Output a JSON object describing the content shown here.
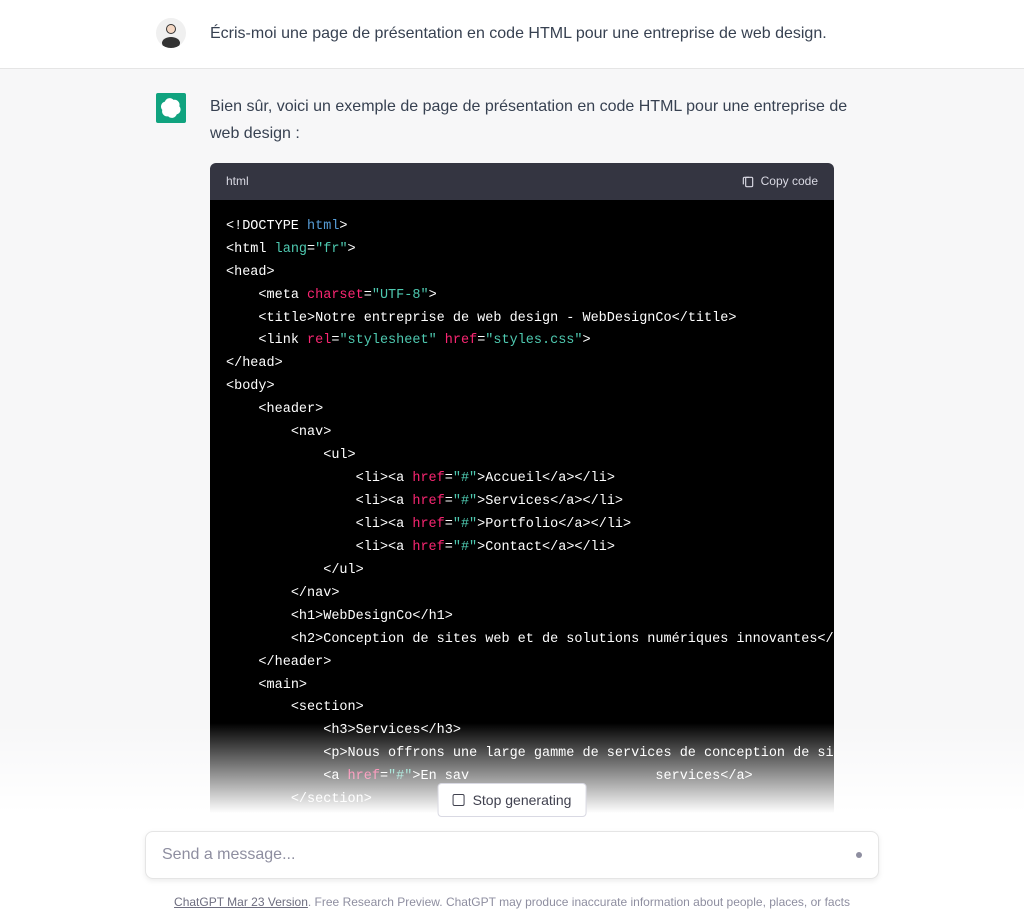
{
  "user_message": "Écris-moi une page de présentation en code HTML pour une entreprise de web design.",
  "assistant_intro": "Bien sûr, voici un exemple de page de présentation en code HTML pour une entreprise de web design :",
  "code": {
    "language": "html",
    "copy_label": "Copy code",
    "lines": [
      {
        "indent": 0,
        "tokens": [
          {
            "t": "<!",
            "c": "w"
          },
          {
            "t": "DOCTYPE ",
            "c": "w"
          },
          {
            "t": "html",
            "c": "blue"
          },
          {
            "t": ">",
            "c": "w"
          }
        ]
      },
      {
        "indent": 0,
        "tokens": [
          {
            "t": "<",
            "c": "w"
          },
          {
            "t": "html ",
            "c": "w"
          },
          {
            "t": "lang",
            "c": "green"
          },
          {
            "t": "=",
            "c": "w"
          },
          {
            "t": "\"fr\"",
            "c": "green"
          },
          {
            "t": ">",
            "c": "w"
          }
        ]
      },
      {
        "indent": 0,
        "tokens": [
          {
            "t": "<",
            "c": "w"
          },
          {
            "t": "head",
            "c": "w"
          },
          {
            "t": ">",
            "c": "w"
          }
        ]
      },
      {
        "indent": 1,
        "tokens": [
          {
            "t": "<",
            "c": "w"
          },
          {
            "t": "meta ",
            "c": "w"
          },
          {
            "t": "charset",
            "c": "red"
          },
          {
            "t": "=",
            "c": "w"
          },
          {
            "t": "\"UTF-8\"",
            "c": "green"
          },
          {
            "t": ">",
            "c": "w"
          }
        ]
      },
      {
        "indent": 1,
        "tokens": [
          {
            "t": "<",
            "c": "w"
          },
          {
            "t": "title",
            "c": "w"
          },
          {
            "t": ">",
            "c": "w"
          },
          {
            "t": "Notre entreprise de web design - WebDesignCo",
            "c": "w"
          },
          {
            "t": "</",
            "c": "w"
          },
          {
            "t": "title",
            "c": "w"
          },
          {
            "t": ">",
            "c": "w"
          }
        ]
      },
      {
        "indent": 1,
        "tokens": [
          {
            "t": "<",
            "c": "w"
          },
          {
            "t": "link ",
            "c": "w"
          },
          {
            "t": "rel",
            "c": "red"
          },
          {
            "t": "=",
            "c": "w"
          },
          {
            "t": "\"stylesheet\"",
            "c": "green"
          },
          {
            "t": " ",
            "c": "w"
          },
          {
            "t": "href",
            "c": "red"
          },
          {
            "t": "=",
            "c": "w"
          },
          {
            "t": "\"styles.css\"",
            "c": "green"
          },
          {
            "t": ">",
            "c": "w"
          }
        ]
      },
      {
        "indent": 0,
        "tokens": [
          {
            "t": "</",
            "c": "w"
          },
          {
            "t": "head",
            "c": "w"
          },
          {
            "t": ">",
            "c": "w"
          }
        ]
      },
      {
        "indent": 0,
        "tokens": [
          {
            "t": "<",
            "c": "w"
          },
          {
            "t": "body",
            "c": "w"
          },
          {
            "t": ">",
            "c": "w"
          }
        ]
      },
      {
        "indent": 1,
        "tokens": [
          {
            "t": "<",
            "c": "w"
          },
          {
            "t": "header",
            "c": "w"
          },
          {
            "t": ">",
            "c": "w"
          }
        ]
      },
      {
        "indent": 2,
        "tokens": [
          {
            "t": "<",
            "c": "w"
          },
          {
            "t": "nav",
            "c": "w"
          },
          {
            "t": ">",
            "c": "w"
          }
        ]
      },
      {
        "indent": 3,
        "tokens": [
          {
            "t": "<",
            "c": "w"
          },
          {
            "t": "ul",
            "c": "w"
          },
          {
            "t": ">",
            "c": "w"
          }
        ]
      },
      {
        "indent": 4,
        "tokens": [
          {
            "t": "<",
            "c": "w"
          },
          {
            "t": "li",
            "c": "w"
          },
          {
            "t": "><",
            "c": "w"
          },
          {
            "t": "a ",
            "c": "w"
          },
          {
            "t": "href",
            "c": "red"
          },
          {
            "t": "=",
            "c": "w"
          },
          {
            "t": "\"#\"",
            "c": "green"
          },
          {
            "t": ">",
            "c": "w"
          },
          {
            "t": "Accueil",
            "c": "w"
          },
          {
            "t": "</",
            "c": "w"
          },
          {
            "t": "a",
            "c": "w"
          },
          {
            "t": "></",
            "c": "w"
          },
          {
            "t": "li",
            "c": "w"
          },
          {
            "t": ">",
            "c": "w"
          }
        ]
      },
      {
        "indent": 4,
        "tokens": [
          {
            "t": "<",
            "c": "w"
          },
          {
            "t": "li",
            "c": "w"
          },
          {
            "t": "><",
            "c": "w"
          },
          {
            "t": "a ",
            "c": "w"
          },
          {
            "t": "href",
            "c": "red"
          },
          {
            "t": "=",
            "c": "w"
          },
          {
            "t": "\"#\"",
            "c": "green"
          },
          {
            "t": ">",
            "c": "w"
          },
          {
            "t": "Services",
            "c": "w"
          },
          {
            "t": "</",
            "c": "w"
          },
          {
            "t": "a",
            "c": "w"
          },
          {
            "t": "></",
            "c": "w"
          },
          {
            "t": "li",
            "c": "w"
          },
          {
            "t": ">",
            "c": "w"
          }
        ]
      },
      {
        "indent": 4,
        "tokens": [
          {
            "t": "<",
            "c": "w"
          },
          {
            "t": "li",
            "c": "w"
          },
          {
            "t": "><",
            "c": "w"
          },
          {
            "t": "a ",
            "c": "w"
          },
          {
            "t": "href",
            "c": "red"
          },
          {
            "t": "=",
            "c": "w"
          },
          {
            "t": "\"#\"",
            "c": "green"
          },
          {
            "t": ">",
            "c": "w"
          },
          {
            "t": "Portfolio",
            "c": "w"
          },
          {
            "t": "</",
            "c": "w"
          },
          {
            "t": "a",
            "c": "w"
          },
          {
            "t": "></",
            "c": "w"
          },
          {
            "t": "li",
            "c": "w"
          },
          {
            "t": ">",
            "c": "w"
          }
        ]
      },
      {
        "indent": 4,
        "tokens": [
          {
            "t": "<",
            "c": "w"
          },
          {
            "t": "li",
            "c": "w"
          },
          {
            "t": "><",
            "c": "w"
          },
          {
            "t": "a ",
            "c": "w"
          },
          {
            "t": "href",
            "c": "red"
          },
          {
            "t": "=",
            "c": "w"
          },
          {
            "t": "\"#\"",
            "c": "green"
          },
          {
            "t": ">",
            "c": "w"
          },
          {
            "t": "Contact",
            "c": "w"
          },
          {
            "t": "</",
            "c": "w"
          },
          {
            "t": "a",
            "c": "w"
          },
          {
            "t": "></",
            "c": "w"
          },
          {
            "t": "li",
            "c": "w"
          },
          {
            "t": ">",
            "c": "w"
          }
        ]
      },
      {
        "indent": 3,
        "tokens": [
          {
            "t": "</",
            "c": "w"
          },
          {
            "t": "ul",
            "c": "w"
          },
          {
            "t": ">",
            "c": "w"
          }
        ]
      },
      {
        "indent": 2,
        "tokens": [
          {
            "t": "</",
            "c": "w"
          },
          {
            "t": "nav",
            "c": "w"
          },
          {
            "t": ">",
            "c": "w"
          }
        ]
      },
      {
        "indent": 2,
        "tokens": [
          {
            "t": "<",
            "c": "w"
          },
          {
            "t": "h1",
            "c": "w"
          },
          {
            "t": ">",
            "c": "w"
          },
          {
            "t": "WebDesignCo",
            "c": "w"
          },
          {
            "t": "</",
            "c": "w"
          },
          {
            "t": "h1",
            "c": "w"
          },
          {
            "t": ">",
            "c": "w"
          }
        ]
      },
      {
        "indent": 2,
        "tokens": [
          {
            "t": "<",
            "c": "w"
          },
          {
            "t": "h2",
            "c": "w"
          },
          {
            "t": ">",
            "c": "w"
          },
          {
            "t": "Conception de sites web et de solutions numériques innovantes",
            "c": "w"
          },
          {
            "t": "</",
            "c": "w"
          },
          {
            "t": "h",
            "c": "w"
          }
        ]
      },
      {
        "indent": 1,
        "tokens": [
          {
            "t": "</",
            "c": "w"
          },
          {
            "t": "header",
            "c": "w"
          },
          {
            "t": ">",
            "c": "w"
          }
        ]
      },
      {
        "indent": 1,
        "tokens": [
          {
            "t": "<",
            "c": "w"
          },
          {
            "t": "main",
            "c": "w"
          },
          {
            "t": ">",
            "c": "w"
          }
        ]
      },
      {
        "indent": 2,
        "tokens": [
          {
            "t": "<",
            "c": "w"
          },
          {
            "t": "section",
            "c": "w"
          },
          {
            "t": ">",
            "c": "w"
          }
        ]
      },
      {
        "indent": 3,
        "tokens": [
          {
            "t": "<",
            "c": "w"
          },
          {
            "t": "h3",
            "c": "w"
          },
          {
            "t": ">",
            "c": "w"
          },
          {
            "t": "Services",
            "c": "w"
          },
          {
            "t": "</",
            "c": "w"
          },
          {
            "t": "h3",
            "c": "w"
          },
          {
            "t": ">",
            "c": "w"
          }
        ]
      },
      {
        "indent": 3,
        "tokens": [
          {
            "t": "<",
            "c": "w"
          },
          {
            "t": "p",
            "c": "w"
          },
          {
            "t": ">",
            "c": "w"
          },
          {
            "t": "Nous offrons une large gamme de services de conception de sit",
            "c": "w"
          }
        ]
      },
      {
        "indent": 3,
        "tokens": [
          {
            "t": "<",
            "c": "w"
          },
          {
            "t": "a ",
            "c": "w"
          },
          {
            "t": "href",
            "c": "red"
          },
          {
            "t": "=",
            "c": "w"
          },
          {
            "t": "\"#\"",
            "c": "green"
          },
          {
            "t": ">",
            "c": "w"
          },
          {
            "t": "En sav",
            "c": "w"
          },
          {
            "t": "                       ",
            "c": "w"
          },
          {
            "t": "services",
            "c": "w"
          },
          {
            "t": "</",
            "c": "w"
          },
          {
            "t": "a",
            "c": "w"
          },
          {
            "t": ">",
            "c": "w"
          }
        ]
      },
      {
        "indent": 2,
        "tokens": [
          {
            "t": "</",
            "c": "w"
          },
          {
            "t": "section",
            "c": "w"
          },
          {
            "t": ">",
            "c": "w"
          }
        ]
      }
    ]
  },
  "stop_label": "Stop generating",
  "input_placeholder": "Send a message...",
  "footer": {
    "version": "ChatGPT Mar 23 Version",
    "rest": ". Free Research Preview. ChatGPT may produce inaccurate information about people, places, or facts"
  }
}
